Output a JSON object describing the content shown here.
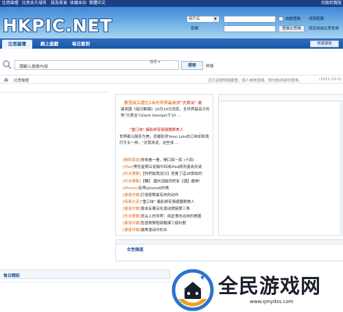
{
  "topbar": {
    "links": [
      "比思論壇",
      "比思永久域名",
      "設為首頁",
      "收藏本站",
      "繁體中文"
    ],
    "right": "切換到寬版"
  },
  "header": {
    "logo": "HKPIC.NET",
    "login": {
      "username_select": "用戶名",
      "password_label": "密碼",
      "auto_login": "自動登錄",
      "login_button": "登錄比思論",
      "find_password": "找回密碼",
      "register": "按這成為比思會員"
    }
  },
  "nav": {
    "tabs": [
      "比思論壇",
      "網上遊戲",
      "每日簽到"
    ],
    "quick_nav": "快捷導航"
  },
  "search": {
    "placeholder": "請輸入搜索內容",
    "type": "搜索",
    "button": "搜索",
    "hot_label": "熱搜:"
  },
  "breadcrumb": {
    "current": "比思論壇",
    "announcement": "近日盜號問題嚴重，個人帳號密碼，請勿設得過份簡單。",
    "date": "(2011-10-3)"
  },
  "featured": {
    "title_prefix": "教授試",
    "title_mid": "立證比2米的世界最高男",
    "title_suffix": "\"大齊治\" 高",
    "body": "據英國《每日郵報》10月24日消息，全世界最高大的狗\"大齊治\"(Giant George)于10 ...",
    "title2": "\"重口味\" 攝影師夸張媒體群美人",
    "body2": "世界都以服务为美，而摄影师Yossi Lolo的口味却和我们不太一样。\"对我来说，这些体 ..."
  },
  "links": [
    {
      "tag": "[精彩笑話]",
      "text": "常來看一看，開口笑一笑 (十四)"
    },
    {
      "tag": "[iPad]",
      "text": "黑色星期五促銷中四成iPad將死者為安桌"
    },
    {
      "tag": "[吹水閒聊]",
      "text": "【你們說我加分】吾覺了這28張說的"
    },
    {
      "tag": "[吹水閒聊]",
      "text": "【轉】 國內頂級同吧有【潮】戲伸！"
    },
    {
      "tag": "[iPhone]",
      "text": "有等iphone6的嗎"
    },
    {
      "tag": "[健身討論]",
      "text": "打造翹臀最有效的动作"
    },
    {
      "tag": "[時事分享]",
      "text": "\"重口味\" 攝影師夸張媒體群美人"
    },
    {
      "tag": "[健身討論]",
      "text": "周末反覆深化運动燃燒第三角"
    },
    {
      "tag": "[吹水閒聊]",
      "text": "丟尖上的世界：用倉食吃出來的美國"
    },
    {
      "tag": "[健身討論]",
      "text": "性感美臀翹部鍛煉三個計劃"
    },
    {
      "tag": "[健身討論]",
      "text": "健美運动中的水"
    }
  ],
  "section_box": {
    "title": "女性頻道"
  },
  "daily": {
    "title": "每日精彩"
  },
  "watermark": {
    "text": "全民游戏网",
    "url": "www.qmydxs.com"
  }
}
